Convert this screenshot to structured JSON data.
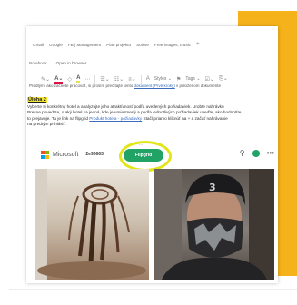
{
  "browser": {
    "bookmarks": [
      "Gmail",
      "Google",
      "FB | Management",
      "Plan projektu",
      "Suisse",
      "Free images, music"
    ]
  },
  "menu": {
    "notebook": "Notebook",
    "open_in_browser": "Open in browser"
  },
  "ribbon": {
    "styles": "Styles",
    "tags": "Tags"
  },
  "page": {
    "fragment_text": "Predtým, ako začnete pracovať, si prosím prečítajte tento ",
    "fragment_link": "dokument (Prvé kroky)",
    "fragment_after": " v priloženom dokumente"
  },
  "task": {
    "title": "Úloha 2",
    "line1": "Vyberte si konkrétny hotel a analyzujte jeho atraktívnosť podľa uvedených požiadaviek. Urobte nahrávku",
    "line2": "Presne povedzte, o aký hotel sa jedná, kde je umiestnený a podľa jednotlivých požiadaviek uveďte, ako hodnotíte",
    "line3_before": "to prejavuje.   Tu je link na flipgrid ",
    "line3_link": "Produkt hotela - požiadavky",
    "line3_after": " Stačí priamo kliknúť na + a začať nahrávanie",
    "line4": "na predtým prihlásiť."
  },
  "call": {
    "app_name": "Microsoft",
    "meeting_id": "2e96663",
    "pill_label": "Flipgrid",
    "ellipsis": "..."
  },
  "colors": {
    "accent": "#f6b21a",
    "pill": "#21a366",
    "highlight": "#f2e631",
    "circle": "#e2e619",
    "link": "#3a6dbf"
  }
}
